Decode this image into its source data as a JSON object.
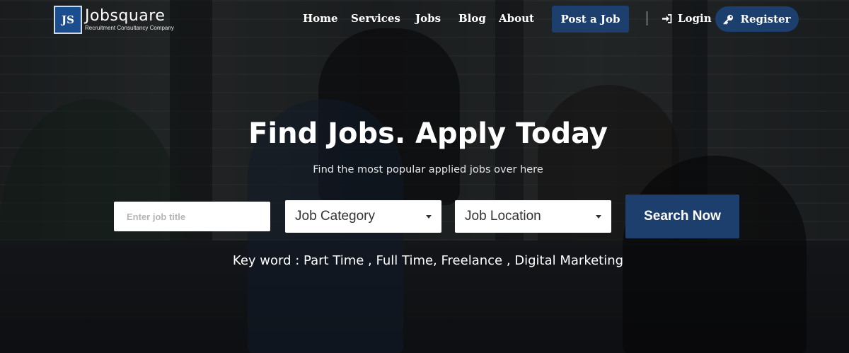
{
  "brand": {
    "mark": "JS",
    "name": "Jobsquare",
    "tagline": "Recruitment Consultancy Company"
  },
  "nav": {
    "items": [
      {
        "label": "Home"
      },
      {
        "label": "Services"
      },
      {
        "label": "Jobs"
      },
      {
        "label": "Blog"
      },
      {
        "label": "About"
      }
    ],
    "post_job": "Post a Job",
    "login": "Login",
    "register": "Register"
  },
  "hero": {
    "title": "Find Jobs. Apply Today",
    "subtitle": "Find the most popular applied jobs over here",
    "search": {
      "job_title_placeholder": "Enter job title",
      "job_title_value": "",
      "category_selected": "Job Category",
      "location_selected": "Job Location",
      "button": "Search Now"
    },
    "keywords": "Key word : Part Time , Full Time, Freelance , Digital Marketing"
  },
  "colors": {
    "accent": "#1c3f6e",
    "logo_bg": "#1b4e8f"
  },
  "icons": {
    "login": "sign-in-icon",
    "register": "key-icon",
    "select_caret": "caret-down-icon"
  }
}
